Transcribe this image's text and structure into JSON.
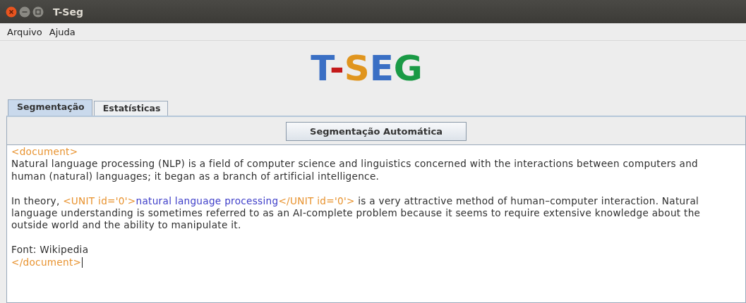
{
  "window": {
    "title": "T-Seg"
  },
  "menu": [
    {
      "label": "Arquivo"
    },
    {
      "label": "Ajuda"
    }
  ],
  "logo": [
    {
      "text": "T",
      "color": "#3a6fc4"
    },
    {
      "text": "-",
      "color": "#c41a1a"
    },
    {
      "text": "S",
      "color": "#e0951e"
    },
    {
      "text": "E",
      "color": "#3a6fc4"
    },
    {
      "text": "G",
      "color": "#1a9a45"
    }
  ],
  "tabs": [
    {
      "label": "Segmentação",
      "selected": true
    },
    {
      "label": "Estatísticas",
      "selected": false
    }
  ],
  "button": {
    "label": "Segmentação Automática"
  },
  "editor": {
    "paragraphs": [
      [
        [
          {
            "kind": "tag",
            "text": "<document>"
          }
        ],
        [
          {
            "kind": "text",
            "text": "Natural language processing (NLP) is a field of computer science and linguistics concerned with the interactions between computers and"
          }
        ],
        [
          {
            "kind": "text",
            "text": "human (natural) languages; it began as a branch of artificial intelligence."
          }
        ]
      ],
      [
        [
          {
            "kind": "text",
            "text": "In theory, "
          },
          {
            "kind": "tag",
            "text": "<UNIT id='0'>"
          },
          {
            "kind": "unit",
            "text": "natural language processing"
          },
          {
            "kind": "tag",
            "text": "</UNIT id='0'>"
          },
          {
            "kind": "text",
            "text": " is a very attractive method of human–computer interaction. Natural"
          }
        ],
        [
          {
            "kind": "text",
            "text": "language understanding is sometimes referred to as an AI-complete problem because it seems to require extensive knowledge about the"
          }
        ],
        [
          {
            "kind": "text",
            "text": "outside world and the ability to manipulate it."
          }
        ]
      ],
      [
        [
          {
            "kind": "text",
            "text": "Font: Wikipedia"
          }
        ],
        [
          {
            "kind": "tag",
            "text": "</document>"
          }
        ]
      ]
    ]
  }
}
